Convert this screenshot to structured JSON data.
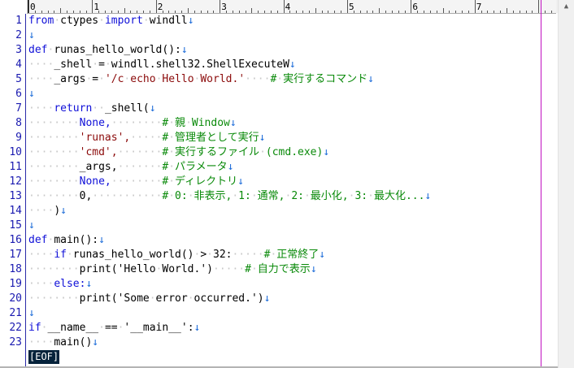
{
  "ruler": {
    "numbers": [
      "0",
      "1",
      "2",
      "3",
      "4",
      "5",
      "6",
      "7"
    ]
  },
  "editor": {
    "line_numbers": [
      "1",
      "2",
      "3",
      "4",
      "5",
      "6",
      "7",
      "8",
      "9",
      "10",
      "11",
      "12",
      "13",
      "14",
      "15",
      "16",
      "17",
      "18",
      "19",
      "20",
      "21",
      "22",
      "23"
    ],
    "eol_marker": "↓",
    "lines": [
      [
        {
          "t": "from",
          "c": "kw"
        },
        {
          "t": "·",
          "c": "ws"
        },
        {
          "t": "ctypes",
          "c": ""
        },
        {
          "t": "·",
          "c": "ws"
        },
        {
          "t": "import",
          "c": "kw"
        },
        {
          "t": "·",
          "c": "ws"
        },
        {
          "t": "windll",
          "c": ""
        }
      ],
      [],
      [
        {
          "t": "def",
          "c": "kw"
        },
        {
          "t": "·",
          "c": "ws"
        },
        {
          "t": "runas_hello_world():",
          "c": ""
        }
      ],
      [
        {
          "t": "····",
          "c": "ws"
        },
        {
          "t": "_shell",
          "c": ""
        },
        {
          "t": "·",
          "c": "ws"
        },
        {
          "t": "=",
          "c": ""
        },
        {
          "t": "·",
          "c": "ws"
        },
        {
          "t": "windll.shell32.ShellExecuteW",
          "c": ""
        }
      ],
      [
        {
          "t": "····",
          "c": "ws"
        },
        {
          "t": "_args",
          "c": ""
        },
        {
          "t": "·",
          "c": "ws"
        },
        {
          "t": "=",
          "c": ""
        },
        {
          "t": "·",
          "c": "ws"
        },
        {
          "t": "'/c",
          "c": "str"
        },
        {
          "t": "·",
          "c": "ws"
        },
        {
          "t": "echo",
          "c": "str"
        },
        {
          "t": "·",
          "c": "ws"
        },
        {
          "t": "Hello",
          "c": "str"
        },
        {
          "t": "·",
          "c": "ws"
        },
        {
          "t": "World.'",
          "c": "str"
        },
        {
          "t": "····",
          "c": "ws"
        },
        {
          "t": "#",
          "c": "cm"
        },
        {
          "t": "·",
          "c": "ws"
        },
        {
          "t": "実行するコマンド",
          "c": "cm"
        }
      ],
      [],
      [
        {
          "t": "····",
          "c": "ws"
        },
        {
          "t": "return",
          "c": "kw"
        },
        {
          "t": "··",
          "c": "ws"
        },
        {
          "t": "_shell(",
          "c": ""
        }
      ],
      [
        {
          "t": "········",
          "c": "ws"
        },
        {
          "t": "None,",
          "c": "kw"
        },
        {
          "t": "········",
          "c": "ws"
        },
        {
          "t": "#",
          "c": "cm"
        },
        {
          "t": "·",
          "c": "ws"
        },
        {
          "t": "親",
          "c": "cm"
        },
        {
          "t": "·",
          "c": "ws"
        },
        {
          "t": "Window",
          "c": "cm"
        }
      ],
      [
        {
          "t": "········",
          "c": "ws"
        },
        {
          "t": "'runas',",
          "c": "str"
        },
        {
          "t": "·····",
          "c": "ws"
        },
        {
          "t": "#",
          "c": "cm"
        },
        {
          "t": "·",
          "c": "ws"
        },
        {
          "t": "管理者として実行",
          "c": "cm"
        }
      ],
      [
        {
          "t": "········",
          "c": "ws"
        },
        {
          "t": "'cmd',",
          "c": "str"
        },
        {
          "t": "·······",
          "c": "ws"
        },
        {
          "t": "#",
          "c": "cm"
        },
        {
          "t": "·",
          "c": "ws"
        },
        {
          "t": "実行するファイル",
          "c": "cm"
        },
        {
          "t": "·",
          "c": "ws"
        },
        {
          "t": "(cmd.exe)",
          "c": "cm"
        }
      ],
      [
        {
          "t": "········",
          "c": "ws"
        },
        {
          "t": "_args,",
          "c": ""
        },
        {
          "t": "·······",
          "c": "ws"
        },
        {
          "t": "#",
          "c": "cm"
        },
        {
          "t": "·",
          "c": "ws"
        },
        {
          "t": "パラメータ",
          "c": "cm"
        }
      ],
      [
        {
          "t": "········",
          "c": "ws"
        },
        {
          "t": "None,",
          "c": "kw"
        },
        {
          "t": "········",
          "c": "ws"
        },
        {
          "t": "#",
          "c": "cm"
        },
        {
          "t": "·",
          "c": "ws"
        },
        {
          "t": "ディレクトリ",
          "c": "cm"
        }
      ],
      [
        {
          "t": "········",
          "c": "ws"
        },
        {
          "t": "0,",
          "c": ""
        },
        {
          "t": "···········",
          "c": "ws"
        },
        {
          "t": "#",
          "c": "cm"
        },
        {
          "t": "·",
          "c": "ws"
        },
        {
          "t": "0:",
          "c": "cm"
        },
        {
          "t": "·",
          "c": "ws"
        },
        {
          "t": "非表示,",
          "c": "cm"
        },
        {
          "t": "·",
          "c": "ws"
        },
        {
          "t": "1:",
          "c": "cm"
        },
        {
          "t": "·",
          "c": "ws"
        },
        {
          "t": "通常,",
          "c": "cm"
        },
        {
          "t": "·",
          "c": "ws"
        },
        {
          "t": "2:",
          "c": "cm"
        },
        {
          "t": "·",
          "c": "ws"
        },
        {
          "t": "最小化,",
          "c": "cm"
        },
        {
          "t": "·",
          "c": "ws"
        },
        {
          "t": "3:",
          "c": "cm"
        },
        {
          "t": "·",
          "c": "ws"
        },
        {
          "t": "最大化...",
          "c": "cm"
        }
      ],
      [
        {
          "t": "····",
          "c": "ws"
        },
        {
          "t": ")",
          "c": ""
        }
      ],
      [],
      [
        {
          "t": "def",
          "c": "kw"
        },
        {
          "t": "·",
          "c": "ws"
        },
        {
          "t": "main():",
          "c": ""
        }
      ],
      [
        {
          "t": "····",
          "c": "ws"
        },
        {
          "t": "if",
          "c": "kw"
        },
        {
          "t": "·",
          "c": "ws"
        },
        {
          "t": "runas_hello_world()",
          "c": ""
        },
        {
          "t": "·",
          "c": "ws"
        },
        {
          "t": ">",
          "c": ""
        },
        {
          "t": "·",
          "c": "ws"
        },
        {
          "t": "32:",
          "c": ""
        },
        {
          "t": "·····",
          "c": "ws"
        },
        {
          "t": "#",
          "c": "cm"
        },
        {
          "t": "·",
          "c": "ws"
        },
        {
          "t": "正常終了",
          "c": "cm"
        }
      ],
      [
        {
          "t": "········",
          "c": "ws"
        },
        {
          "t": "print('Hello",
          "c": ""
        },
        {
          "t": "·",
          "c": "ws"
        },
        {
          "t": "World.')",
          "c": ""
        },
        {
          "t": "·····",
          "c": "ws"
        },
        {
          "t": "#",
          "c": "cm"
        },
        {
          "t": "·",
          "c": "ws"
        },
        {
          "t": "自力で表示",
          "c": "cm"
        }
      ],
      [
        {
          "t": "····",
          "c": "ws"
        },
        {
          "t": "else:",
          "c": "kw"
        }
      ],
      [
        {
          "t": "········",
          "c": "ws"
        },
        {
          "t": "print('Some",
          "c": ""
        },
        {
          "t": "·",
          "c": "ws"
        },
        {
          "t": "error",
          "c": ""
        },
        {
          "t": "·",
          "c": "ws"
        },
        {
          "t": "occurred.')",
          "c": ""
        }
      ],
      [],
      [
        {
          "t": "if",
          "c": "kw"
        },
        {
          "t": "·",
          "c": "ws"
        },
        {
          "t": "__name__",
          "c": ""
        },
        {
          "t": "·",
          "c": "ws"
        },
        {
          "t": "==",
          "c": ""
        },
        {
          "t": "·",
          "c": "ws"
        },
        {
          "t": "'__main__':",
          "c": ""
        }
      ],
      [
        {
          "t": "····",
          "c": "ws"
        },
        {
          "t": "main()",
          "c": ""
        }
      ]
    ],
    "eof_label": "[EOF]"
  },
  "colors": {
    "keyword": "#1010d8",
    "string": "#8b0a0a",
    "comment": "#0a8a0a",
    "line_number": "#1a1ab0",
    "eol_marker": "#1a6ad8",
    "wrap_guide": "#c010c0",
    "eof_bg": "#05223b"
  },
  "scrollbar": {
    "up_icon": "▲"
  }
}
